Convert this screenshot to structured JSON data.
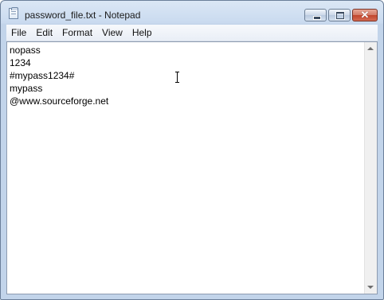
{
  "window": {
    "title": "password_file.txt - Notepad",
    "close_glyph": "✕",
    "icons": {
      "app": "notepad-icon",
      "minimize": "minimize-icon",
      "maximize": "maximize-icon",
      "close": "close-icon",
      "scroll_up": "arrow-up-icon",
      "scroll_down": "arrow-down-icon",
      "cursor": "text-cursor-icon"
    }
  },
  "menu": {
    "items": [
      "File",
      "Edit",
      "Format",
      "View",
      "Help"
    ]
  },
  "editor": {
    "lines": [
      "nopass",
      "1234",
      "#mypass1234#",
      "mypass",
      "@www.sourceforge.net"
    ]
  }
}
